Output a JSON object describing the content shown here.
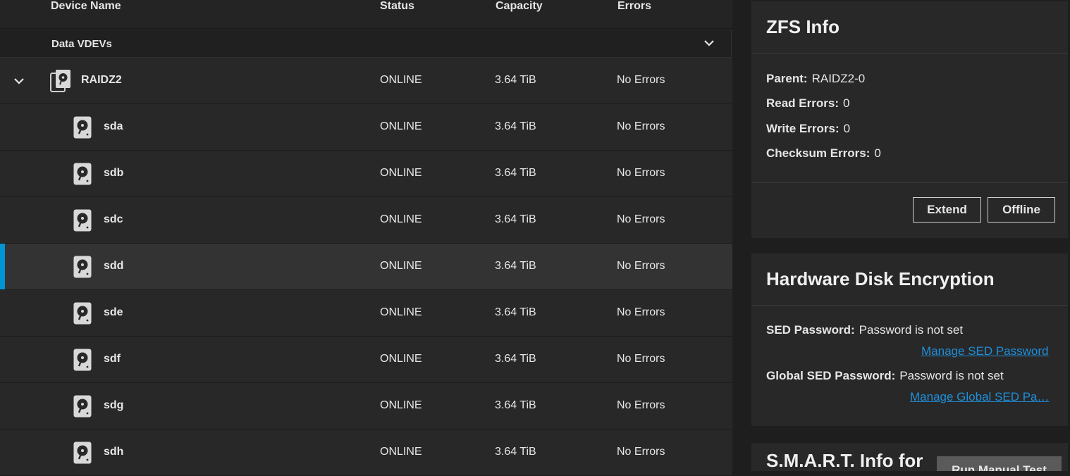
{
  "table": {
    "headers": {
      "device_name": "Device Name",
      "status": "Status",
      "capacity": "Capacity",
      "errors": "Errors"
    },
    "group_label": "Data VDEVs",
    "vdev": {
      "name": "RAIDZ2",
      "status": "ONLINE",
      "capacity": "3.64 TiB",
      "errors": "No Errors"
    },
    "disks": [
      {
        "name": "sda",
        "status": "ONLINE",
        "capacity": "3.64 TiB",
        "errors": "No Errors"
      },
      {
        "name": "sdb",
        "status": "ONLINE",
        "capacity": "3.64 TiB",
        "errors": "No Errors"
      },
      {
        "name": "sdc",
        "status": "ONLINE",
        "capacity": "3.64 TiB",
        "errors": "No Errors"
      },
      {
        "name": "sdd",
        "status": "ONLINE",
        "capacity": "3.64 TiB",
        "errors": "No Errors",
        "selected": true
      },
      {
        "name": "sde",
        "status": "ONLINE",
        "capacity": "3.64 TiB",
        "errors": "No Errors"
      },
      {
        "name": "sdf",
        "status": "ONLINE",
        "capacity": "3.64 TiB",
        "errors": "No Errors"
      },
      {
        "name": "sdg",
        "status": "ONLINE",
        "capacity": "3.64 TiB",
        "errors": "No Errors"
      },
      {
        "name": "sdh",
        "status": "ONLINE",
        "capacity": "3.64 TiB",
        "errors": "No Errors"
      }
    ],
    "icons": {
      "expand": "chevron-down-icon",
      "vdev": "vdev-disks-icon",
      "disk": "hard-disk-icon",
      "group_toggle": "chevron-down-icon"
    }
  },
  "zfs_info": {
    "title": "ZFS Info",
    "parent_label": "Parent:",
    "parent_value": "RAIDZ2-0",
    "read_errors_label": "Read Errors:",
    "read_errors_value": "0",
    "write_errors_label": "Write Errors:",
    "write_errors_value": "0",
    "checksum_errors_label": "Checksum Errors:",
    "checksum_errors_value": "0",
    "extend_label": "Extend",
    "offline_label": "Offline"
  },
  "encryption": {
    "title": "Hardware Disk Encryption",
    "sed_password_label": "SED Password:",
    "sed_password_value": "Password is not set",
    "manage_sed_link": "Manage SED Password",
    "global_sed_password_label": "Global SED Password:",
    "global_sed_password_value": "Password is not set",
    "manage_global_sed_link": "Manage Global SED Pa…"
  },
  "smart": {
    "title": "S.M.A.R.T. Info for",
    "run_test_label": "Run Manual Test"
  },
  "colors": {
    "accent": "#0095d5",
    "link": "#1f8fd9",
    "background": "#1e1e1e",
    "panel": "#282828"
  }
}
